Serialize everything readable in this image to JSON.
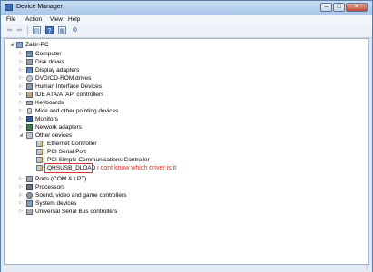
{
  "window": {
    "title": "Device Manager",
    "controls": {
      "minimize": "–",
      "maximize": "□",
      "close": "✕"
    }
  },
  "menu": [
    "File",
    "Action",
    "View",
    "Help"
  ],
  "toolbar": {
    "back": "⇦",
    "forward": "⇨",
    "properties": "▤",
    "help": "?",
    "view": "▦",
    "scan": "⚙"
  },
  "tree": {
    "root": "Zakir-PC",
    "categories": [
      "Computer",
      "Disk drives",
      "Display adapters",
      "DVD/CD-ROM drives",
      "Human Interface Devices",
      "IDE ATA/ATAPI controllers",
      "Keyboards",
      "Mice and other pointing devices",
      "Monitors",
      "Network adapters",
      "Other devices"
    ],
    "other_devices": [
      "Ethernet Controller",
      "PCI Serial Port",
      "PCI Simple Communications Controller",
      "QHSUSB_DLOAD"
    ],
    "categories_after": [
      "Ports (COM & LPT)",
      "Processors",
      "Sound, video and game controllers",
      "System devices",
      "Universal Serial Bus controllers"
    ]
  },
  "annotation": "i dont know which driver is it",
  "colors": {
    "annotation": "#d9312b",
    "warning": "#d08a00"
  }
}
